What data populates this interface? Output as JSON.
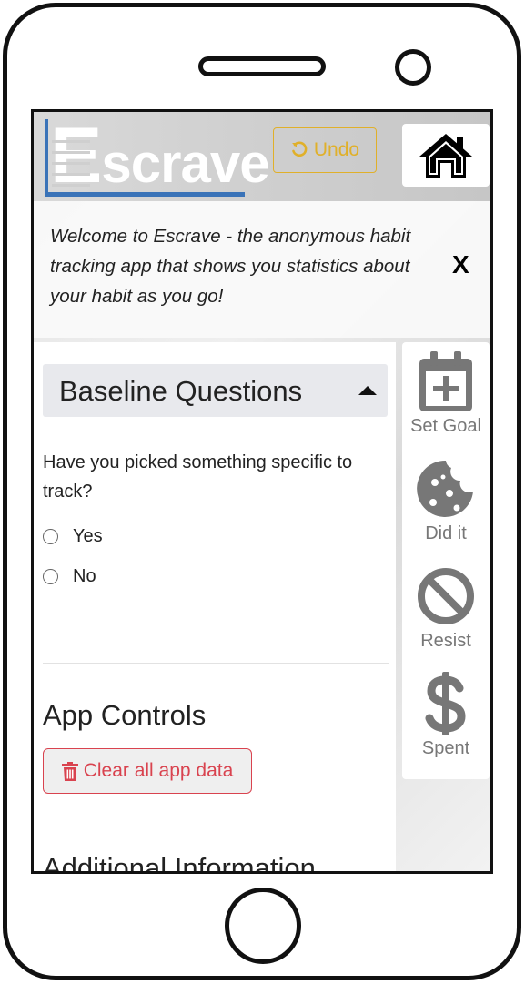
{
  "header": {
    "logo_text_e": "E",
    "logo_text_rest": "scrave",
    "undo_label": "Undo",
    "home_icon": "home-icon"
  },
  "welcome": {
    "text": "Welcome to Escrave - the anonymous habit tracking app that shows you statistics about your habit as you go!",
    "close_label": "X"
  },
  "baseline": {
    "title": "Baseline Questions",
    "question": "Have you picked something specific to track?",
    "options": [
      {
        "label": "Yes",
        "selected": false
      },
      {
        "label": "No",
        "selected": false
      }
    ]
  },
  "app_controls": {
    "title": "App Controls",
    "clear_label": "Clear all app data"
  },
  "additional": {
    "title": "Additional Information"
  },
  "actions": [
    {
      "label": "Set Goal",
      "icon": "calendar-plus-icon"
    },
    {
      "label": "Did it",
      "icon": "cookie-icon"
    },
    {
      "label": "Resist",
      "icon": "ban-icon"
    },
    {
      "label": "Spent",
      "icon": "dollar-icon"
    }
  ],
  "colors": {
    "accent_warning": "#e0b02a",
    "danger": "#d9434f",
    "logo_blue": "#3a73b8",
    "icon_gray": "#777777"
  }
}
